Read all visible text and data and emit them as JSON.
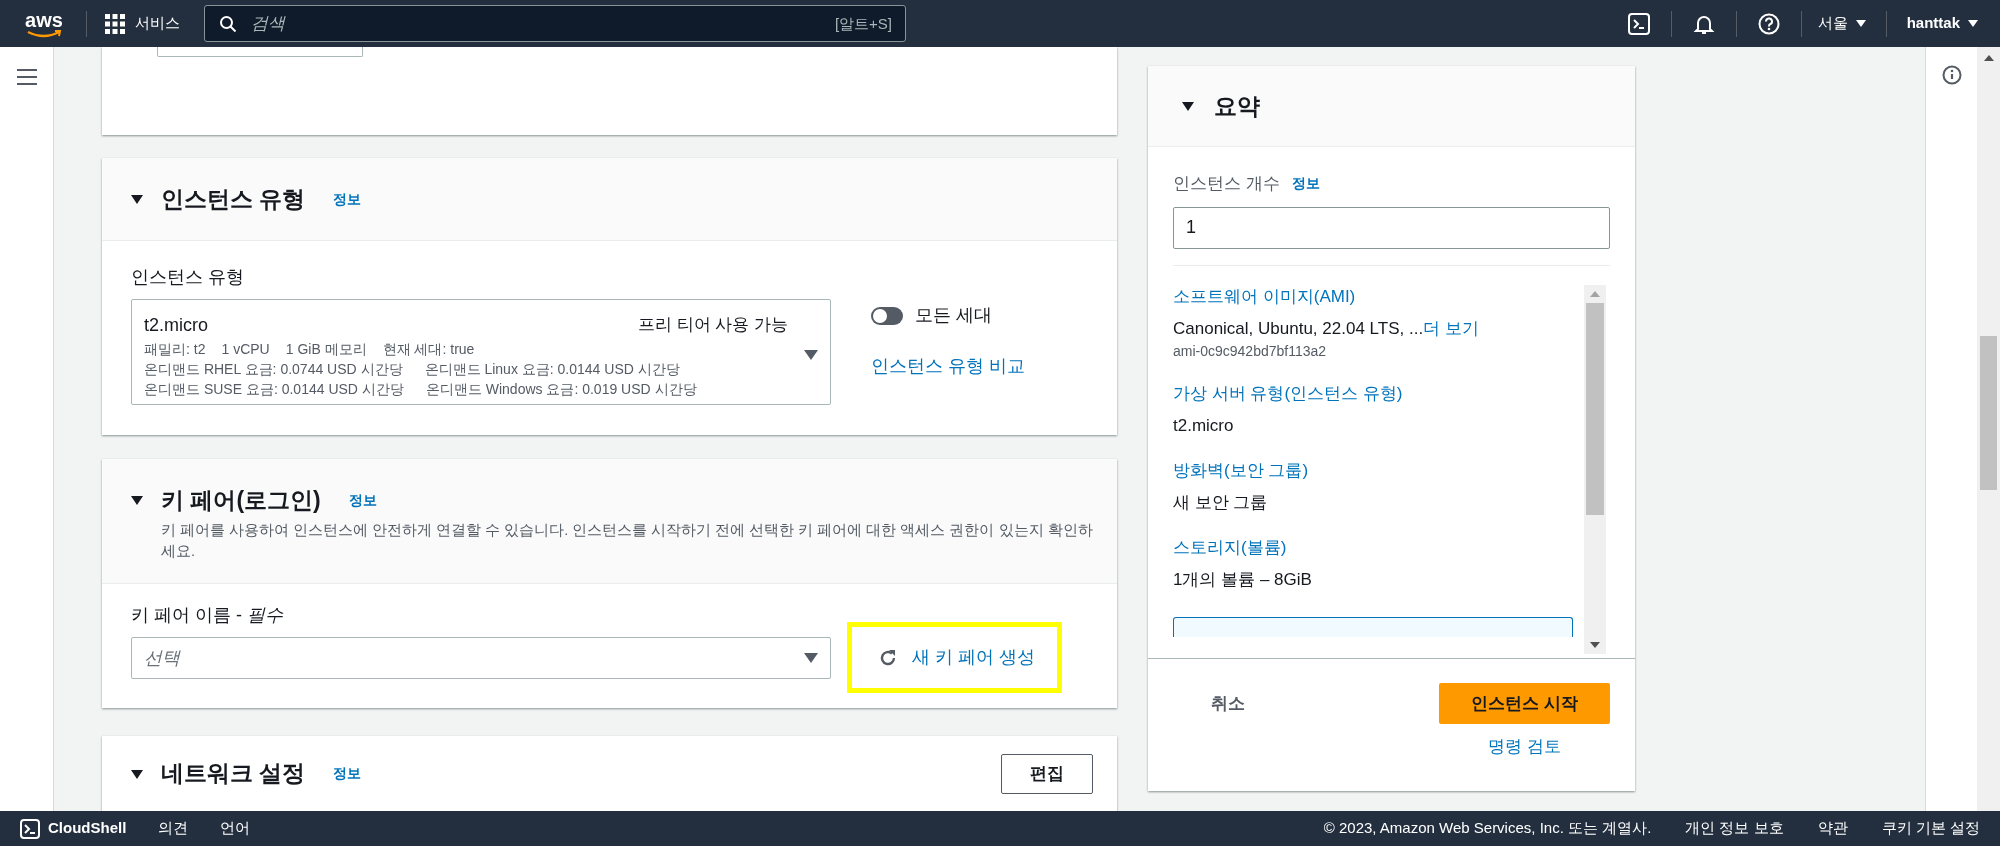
{
  "top_nav": {
    "logo": "aws",
    "services": "서비스",
    "search": {
      "placeholder": "검색",
      "shortcut": "[알트+S]"
    },
    "region": "서울",
    "user": "hanttak"
  },
  "instance_type": {
    "expanded": true,
    "title": "인스턴스 유형",
    "info": "정보",
    "field_label": "인스턴스 유형",
    "selected_type": {
      "name": "t2.micro",
      "badge": "프리 티어 사용 가능",
      "details": [
        [
          "패밀리: t2",
          "1 vCPU",
          "1 GiB 메모리",
          "현재 세대: true"
        ],
        [
          "온디맨드 RHEL 요금: 0.0744 USD 시간당",
          "온디맨드 Linux 요금: 0.0144 USD 시간당"
        ],
        [
          "온디맨드 SUSE 요금: 0.0144 USD 시간당",
          "온디맨드 Windows 요금: 0.019 USD 시간당"
        ]
      ]
    },
    "all_generations_toggle": {
      "label": "모든 세대",
      "on": false
    },
    "compare_link": "인스턴스 유형 비교"
  },
  "key_pair": {
    "expanded": true,
    "title": "키 페어(로그인)",
    "info": "정보",
    "description": "키 페어를 사용하여 인스턴스에 안전하게 연결할 수 있습니다. 인스턴스를 시작하기 전에 선택한 키 페어에 대한 액세스 권한이 있는지 확인하세요.",
    "field_label": "키 페어 이름 - *필수*",
    "placeholder": "선택",
    "create_button": {
      "label": "새 키 페어 생성",
      "highlighted": true
    }
  },
  "network": {
    "expanded": true,
    "title": "네트워크 설정",
    "info": "정보",
    "edit_button": "편집"
  },
  "summary": {
    "expanded": true,
    "title": "요약",
    "count_label": "인스턴스 개수",
    "info": "정보",
    "count_value": "1",
    "items": [
      {
        "heading": "소프트웨어 이미지(AMI)",
        "value": "Canonical, Ubuntu, 22.04 LTS, ...",
        "more": "더 보기",
        "sub": "ami-0c9c942bd7bf113a2"
      },
      {
        "heading": "가상 서버 유형(인스턴스 유형)",
        "value": "t2.micro"
      },
      {
        "heading": "방화벽(보안 그룹)",
        "value": "새 보안 그룹"
      },
      {
        "heading": "스토리지(볼륨)",
        "value": "1개의 볼륨 – 8GiB"
      }
    ],
    "cancel": "취소",
    "launch": "인스턴스 시작",
    "review": "명령 검토"
  },
  "footer": {
    "cloudshell": "CloudShell",
    "links_left": [
      "의견",
      "언어"
    ],
    "copyright": "© 2023, Amazon Web Services, Inc. 또는 계열사.",
    "links_right": [
      "개인 정보 보호",
      "약관",
      "쿠키 기본 설정"
    ]
  }
}
